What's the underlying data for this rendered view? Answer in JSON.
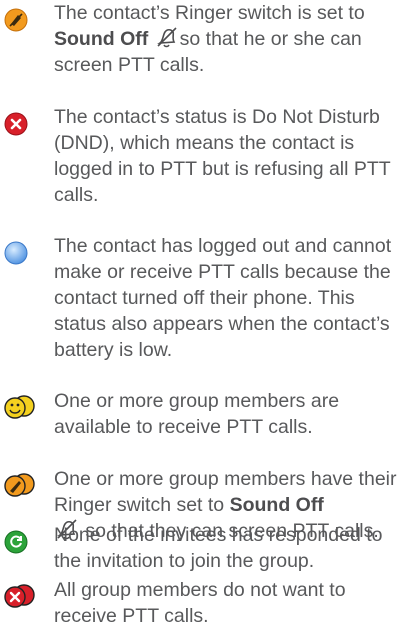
{
  "entries": [
    {
      "icon": "ringer-off-orange-icon",
      "text_before": "The contact’s Ringer switch is set to ",
      "bold": "Sound Off",
      "text_after": "so that he or she can screen PTT calls."
    },
    {
      "icon": "do-not-disturb-red-icon",
      "text": "The contact’s status is Do Not Disturb (DND), which means the contact is logged in to PTT but is refusing all PTT calls."
    },
    {
      "icon": "logged-out-blue-icon",
      "text": "The contact has logged out and cannot make or receive PTT calls because the contact turned off their phone. This status also appears when the contact’s battery is low."
    },
    {
      "icon": "group-available-icon",
      "text": "One or more group members are available to receive PTT calls."
    },
    {
      "icon": "group-ringer-off-icon",
      "text_before": "One or more group members have their Ringer switch set to ",
      "bold": "Sound Off",
      "text_after": " so that they can screen PTT calls."
    },
    {
      "icon": "invite-pending-green-icon",
      "text": "None of the invitees has responded to the invitation to join the group."
    },
    {
      "icon": "group-dnd-icon",
      "text": "All group members do not want to receive PTT calls."
    }
  ],
  "colors": {
    "text": "#58595b",
    "orange": "#f29a1e",
    "red": "#d8202a",
    "blue": "#6aa9e9",
    "yellow": "#f4d11f",
    "green": "#2ca33a"
  }
}
